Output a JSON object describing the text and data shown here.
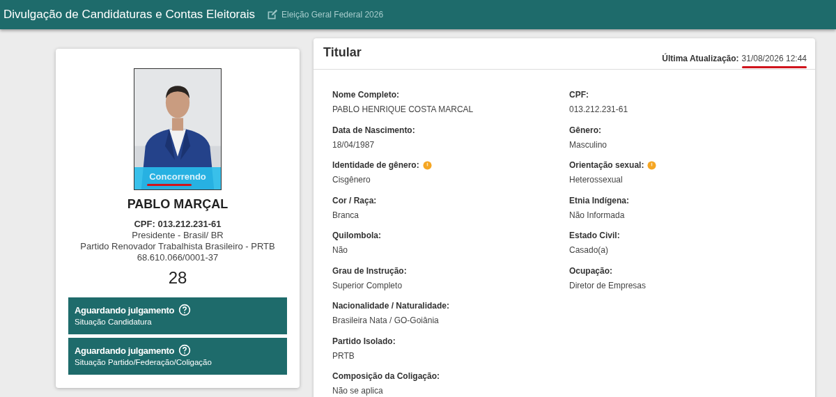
{
  "header": {
    "title": "Divulgação de Candidaturas e Contas Eleitorais",
    "election": "Eleição Geral Federal 2026"
  },
  "candidate": {
    "status": {
      "text": "Concorrendo",
      "underlined": true
    },
    "name": "PABLO MARÇAL",
    "cpf": "CPF: 013.212.231-61",
    "office": "Presidente - Brasil/ BR",
    "party": "Partido Renovador Trabalhista Brasileiro - PRTB",
    "cnpj": "68.610.066/0001-37",
    "number": "28",
    "situations": [
      {
        "title": "Aguardando julgamento",
        "subtitle": "Situação Candidatura"
      },
      {
        "title": "Aguardando julgamento",
        "subtitle": "Situação Partido/Federação/Coligação"
      }
    ]
  },
  "panel": {
    "title": "Titular",
    "updated_label": "Última Atualização:",
    "updated_value": "31/08/2026 12:44",
    "updated_underlined": true,
    "rows": [
      [
        {
          "label": "Nome Completo:",
          "value": "PABLO HENRIQUE COSTA MARCAL",
          "info": false
        },
        {
          "label": "CPF:",
          "value": "013.212.231-61",
          "info": false
        }
      ],
      [
        {
          "label": "Data de Nascimento:",
          "value": "18/04/1987",
          "info": false
        },
        {
          "label": "Gênero:",
          "value": "Masculino",
          "info": false
        }
      ],
      [
        {
          "label": "Identidade de gênero:",
          "value": "Cisgênero",
          "info": true
        },
        {
          "label": "Orientação sexual:",
          "value": "Heterossexual",
          "info": true
        }
      ],
      [
        {
          "label": "Cor / Raça:",
          "value": "Branca",
          "info": false
        },
        {
          "label": "Etnia Indígena:",
          "value": "Não Informada",
          "info": false
        }
      ],
      [
        {
          "label": "Quilombola:",
          "value": "Não",
          "info": false
        },
        {
          "label": "Estado Civil:",
          "value": "Casado(a)",
          "info": false
        }
      ],
      [
        {
          "label": "Grau de Instrução:",
          "value": "Superior Completo",
          "info": false
        },
        {
          "label": "Ocupação:",
          "value": "Diretor de Empresas",
          "info": false
        }
      ],
      [
        {
          "label": "Nacionalidade / Naturalidade:",
          "value": "Brasileira Nata / GO-Goiânia",
          "info": false
        }
      ],
      [
        {
          "label": "Partido Isolado:",
          "value": "PRTB",
          "info": false
        }
      ],
      [
        {
          "label": "Composição da Coligação:",
          "value": "Não se aplica",
          "info": false
        }
      ]
    ]
  }
}
